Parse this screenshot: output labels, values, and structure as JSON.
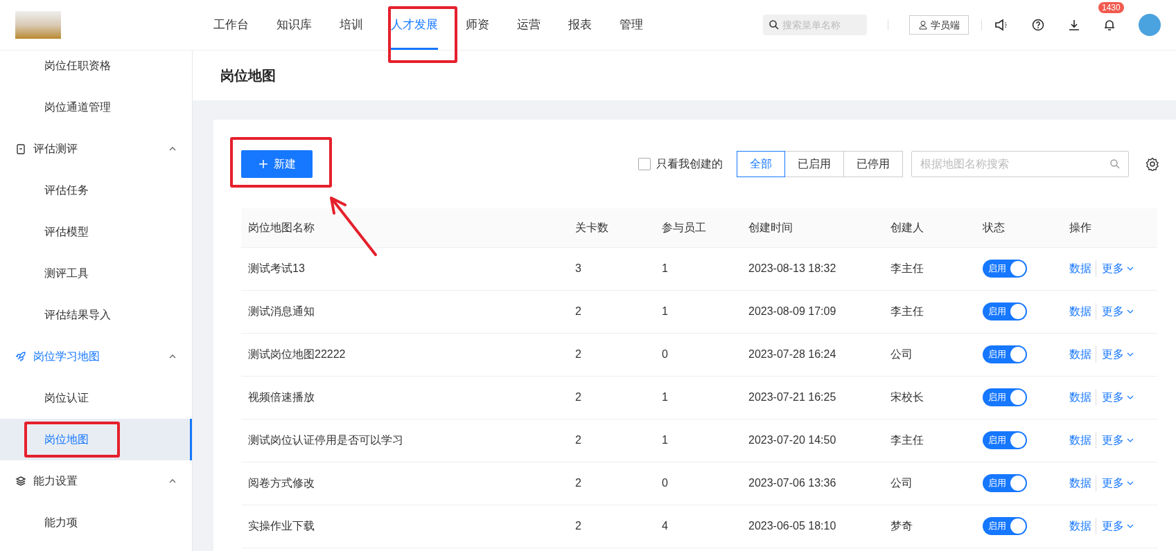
{
  "header": {
    "nav": [
      {
        "label": "工作台",
        "selected": false
      },
      {
        "label": "知识库",
        "selected": false
      },
      {
        "label": "培训",
        "selected": false
      },
      {
        "label": "人才发展",
        "selected": true
      },
      {
        "label": "师资",
        "selected": false
      },
      {
        "label": "运营",
        "selected": false
      },
      {
        "label": "报表",
        "selected": false
      },
      {
        "label": "管理",
        "selected": false
      }
    ],
    "search": {
      "placeholder": "搜索菜单名称"
    },
    "student_button": "学员端",
    "notification_badge": "1430"
  },
  "sidebar": {
    "items": [
      {
        "kind": "item",
        "label": "岗位任职资格",
        "selected": false
      },
      {
        "kind": "item",
        "label": "岗位通道管理",
        "selected": false
      },
      {
        "kind": "group",
        "label": "评估测评",
        "expanded": true,
        "selected": false
      },
      {
        "kind": "item",
        "label": "评估任务",
        "selected": false
      },
      {
        "kind": "item",
        "label": "评估模型",
        "selected": false
      },
      {
        "kind": "item",
        "label": "测评工具",
        "selected": false
      },
      {
        "kind": "item",
        "label": "评估结果导入",
        "selected": false
      },
      {
        "kind": "group",
        "label": "岗位学习地图",
        "expanded": true,
        "selected": true
      },
      {
        "kind": "item",
        "label": "岗位认证",
        "selected": false
      },
      {
        "kind": "item",
        "label": "岗位地图",
        "selected": true
      },
      {
        "kind": "group",
        "label": "能力设置",
        "expanded": true,
        "selected": false
      },
      {
        "kind": "item",
        "label": "能力项",
        "selected": false
      }
    ]
  },
  "page_title": "岗位地图",
  "toolbar": {
    "new_button": "新建",
    "only_mine": {
      "label": "只看我创建的",
      "checked": false
    },
    "filters": [
      {
        "label": "全部",
        "selected": true
      },
      {
        "label": "已启用",
        "selected": false
      },
      {
        "label": "已停用",
        "selected": false
      }
    ],
    "search": {
      "placeholder": "根据地图名称搜索"
    }
  },
  "table": {
    "columns": [
      "岗位地图名称",
      "关卡数",
      "参与员工",
      "创建时间",
      "创建人",
      "状态",
      "操作"
    ],
    "rows": [
      {
        "name": "测试考试13",
        "stages": "3",
        "participants": "1",
        "created": "2023-08-13 18:32",
        "creator": "李主任",
        "status": {
          "label": "启用",
          "on": true
        },
        "actions": [
          "数据",
          "更多"
        ]
      },
      {
        "name": "测试消息通知",
        "stages": "2",
        "participants": "1",
        "created": "2023-08-09 17:09",
        "creator": "李主任",
        "status": {
          "label": "启用",
          "on": true
        },
        "actions": [
          "数据",
          "更多"
        ]
      },
      {
        "name": "测试岗位地图22222",
        "stages": "2",
        "participants": "0",
        "created": "2023-07-28 16:24",
        "creator": "公司",
        "status": {
          "label": "启用",
          "on": true
        },
        "actions": [
          "数据",
          "更多"
        ]
      },
      {
        "name": "视频倍速播放",
        "stages": "2",
        "participants": "1",
        "created": "2023-07-21 16:25",
        "creator": "宋校长",
        "status": {
          "label": "启用",
          "on": true
        },
        "actions": [
          "数据",
          "更多"
        ]
      },
      {
        "name": "测试岗位认证停用是否可以学习",
        "stages": "2",
        "participants": "1",
        "created": "2023-07-20 14:50",
        "creator": "李主任",
        "status": {
          "label": "启用",
          "on": true
        },
        "actions": [
          "数据",
          "更多"
        ]
      },
      {
        "name": "阅卷方式修改",
        "stages": "2",
        "participants": "0",
        "created": "2023-07-06 13:36",
        "creator": "公司",
        "status": {
          "label": "启用",
          "on": true
        },
        "actions": [
          "数据",
          "更多"
        ]
      },
      {
        "name": "实操作业下载",
        "stages": "2",
        "participants": "4",
        "created": "2023-06-05 18:10",
        "creator": "梦奇",
        "status": {
          "label": "启用",
          "on": true
        },
        "actions": [
          "数据",
          "更多"
        ]
      }
    ]
  }
}
